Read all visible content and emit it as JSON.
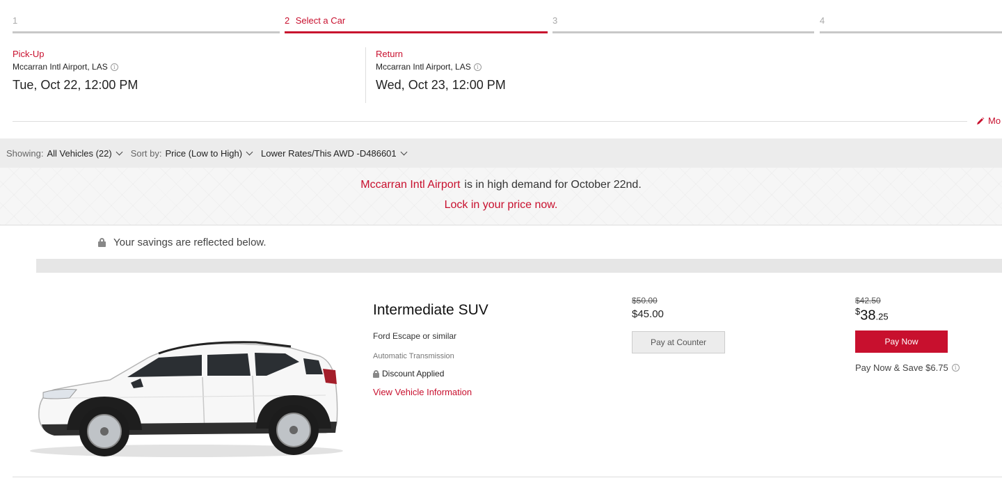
{
  "steps": [
    {
      "num": "1",
      "label": ""
    },
    {
      "num": "2",
      "label": "Select a Car"
    },
    {
      "num": "3",
      "label": ""
    },
    {
      "num": "4",
      "label": ""
    }
  ],
  "trip": {
    "pickup": {
      "heading": "Pick-Up",
      "location": "Mccarran Intl Airport, LAS",
      "datetime": "Tue, Oct 22, 12:00 PM"
    },
    "return": {
      "heading": "Return",
      "location": "Mccarran Intl Airport, LAS",
      "datetime": "Wed, Oct 23, 12:00 PM"
    },
    "modify_label": "Mo"
  },
  "filters": {
    "showing_label": "Showing:",
    "showing_value": "All Vehicles (22)",
    "sort_label": "Sort by:",
    "sort_value": "Price (Low to High)",
    "rate_value": "Lower Rates/This AWD -D486601"
  },
  "demand_banner": {
    "location": "Mccarran Intl Airport",
    "message": "is in high demand for October 22nd.",
    "cta": "Lock in your price now."
  },
  "savings_note": "Your savings are reflected below.",
  "vehicle": {
    "class": "Intermediate SUV",
    "model": "Ford Escape or similar",
    "transmission": "Automatic Transmission",
    "discount": "Discount Applied",
    "info_link": "View Vehicle Information",
    "counter": {
      "original": "$50.00",
      "price": "$45.00",
      "button": "Pay at Counter"
    },
    "paynow": {
      "original": "$42.50",
      "currency": "$",
      "dollars": "38",
      "cents": ".25",
      "button": "Pay Now",
      "savings": "Pay Now & Save $6.75"
    }
  },
  "colors": {
    "accent": "#c8102e",
    "filter_bar": "#ececec"
  }
}
